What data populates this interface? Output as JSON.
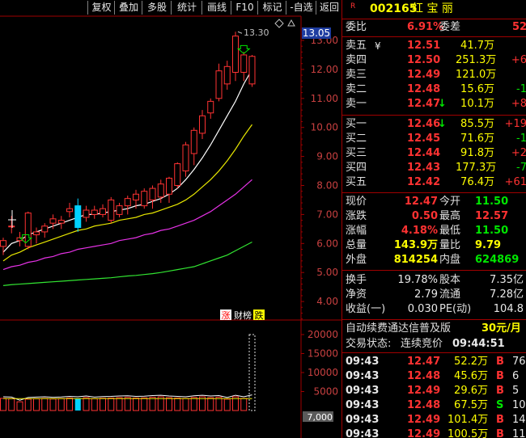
{
  "toolbar": {
    "buttons": [
      "复权",
      "叠加",
      "多股",
      "统计",
      "画线",
      "F10",
      "标记",
      "-自选",
      "返回"
    ]
  },
  "chart": {
    "price_axis_labels": [
      "13.00",
      "12.00",
      "11.00",
      "10.00",
      "9.00",
      "8.00",
      "7.00",
      "6.00",
      "5.00",
      "4.00"
    ],
    "current_price_tag": "13.05",
    "high_label": "13.30",
    "badge_zhang": "涨",
    "badge_caibang": "财榜",
    "badge_die": "跌",
    "volume_axis_labels": [
      "20000",
      "15000",
      "10000",
      "5000"
    ],
    "volume_label": "7,000",
    "colors": {
      "up": "#ff3232",
      "down": "#00d2ff",
      "ma5": "#ffffff",
      "ma10": "#e6e600",
      "ma20": "#e632e6",
      "ma60": "#32e632",
      "grid": "#a00000"
    }
  },
  "chart_data": {
    "type": "candlestick",
    "candles": [
      {
        "o": 5.9,
        "h": 6.2,
        "l": 5.6,
        "c": 6.1
      },
      {
        "o": 6.6,
        "h": 6.95,
        "l": 6.35,
        "c": 6.6
      },
      {
        "o": 6.1,
        "h": 6.4,
        "l": 5.9,
        "c": 6.2
      },
      {
        "o": 5.9,
        "h": 7.1,
        "l": 5.8,
        "c": 7.05
      },
      {
        "o": 6.3,
        "h": 6.55,
        "l": 6.0,
        "c": 6.4
      },
      {
        "o": 6.4,
        "h": 6.7,
        "l": 6.2,
        "c": 6.6
      },
      {
        "o": 6.7,
        "h": 7.0,
        "l": 6.5,
        "c": 6.85
      },
      {
        "o": 6.7,
        "h": 6.95,
        "l": 6.5,
        "c": 6.8
      },
      {
        "o": 7.1,
        "h": 7.4,
        "l": 6.9,
        "c": 7.2
      },
      {
        "o": 7.3,
        "h": 7.55,
        "l": 6.4,
        "c": 6.55
      },
      {
        "o": 6.9,
        "h": 7.3,
        "l": 6.75,
        "c": 7.15
      },
      {
        "o": 7.0,
        "h": 7.3,
        "l": 6.85,
        "c": 7.15
      },
      {
        "o": 7.0,
        "h": 7.35,
        "l": 6.9,
        "c": 7.2
      },
      {
        "o": 6.8,
        "h": 7.6,
        "l": 6.7,
        "c": 7.5
      },
      {
        "o": 7.0,
        "h": 7.4,
        "l": 6.9,
        "c": 7.3
      },
      {
        "o": 7.3,
        "h": 7.65,
        "l": 7.0,
        "c": 7.55
      },
      {
        "o": 7.5,
        "h": 7.85,
        "l": 7.2,
        "c": 7.7
      },
      {
        "o": 7.3,
        "h": 7.9,
        "l": 7.2,
        "c": 7.8
      },
      {
        "o": 7.5,
        "h": 8.0,
        "l": 7.2,
        "c": 7.9
      },
      {
        "o": 7.6,
        "h": 8.2,
        "l": 7.4,
        "c": 8.05
      },
      {
        "o": 7.7,
        "h": 8.3,
        "l": 7.4,
        "c": 8.25
      },
      {
        "o": 8.0,
        "h": 8.8,
        "l": 7.9,
        "c": 8.75
      },
      {
        "o": 8.5,
        "h": 9.5,
        "l": 8.3,
        "c": 9.4
      },
      {
        "o": 9.1,
        "h": 10.0,
        "l": 8.7,
        "c": 9.9
      },
      {
        "o": 9.8,
        "h": 10.6,
        "l": 9.6,
        "c": 10.4
      },
      {
        "o": 10.5,
        "h": 11.0,
        "l": 10.3,
        "c": 10.9
      },
      {
        "o": 11.0,
        "h": 12.2,
        "l": 10.9,
        "c": 11.95
      },
      {
        "o": 11.5,
        "h": 12.3,
        "l": 11.3,
        "c": 12.1
      },
      {
        "o": 11.9,
        "h": 13.3,
        "l": 11.6,
        "c": 13.15
      },
      {
        "o": 11.9,
        "h": 12.6,
        "l": 11.6,
        "c": 12.5
      },
      {
        "o": 11.5,
        "h": 12.5,
        "l": 11.4,
        "c": 12.45
      }
    ],
    "ma5": [
      5.7,
      6.0,
      6.1,
      6.3,
      6.4,
      6.5,
      6.6,
      6.7,
      6.8,
      6.9,
      7.0,
      7.0,
      7.05,
      7.1,
      7.15,
      7.2,
      7.3,
      7.35,
      7.45,
      7.55,
      7.7,
      7.9,
      8.2,
      8.55,
      8.95,
      9.4,
      9.9,
      10.4,
      10.9,
      11.5,
      12.0
    ],
    "ma10": [
      5.4,
      5.6,
      5.7,
      5.85,
      5.95,
      6.05,
      6.15,
      6.25,
      6.35,
      6.45,
      6.5,
      6.6,
      6.65,
      6.7,
      6.8,
      6.85,
      6.9,
      7.0,
      7.05,
      7.15,
      7.25,
      7.35,
      7.5,
      7.7,
      7.95,
      8.2,
      8.5,
      8.85,
      9.25,
      9.7,
      10.1
    ],
    "ma20": [
      5.1,
      5.2,
      5.25,
      5.35,
      5.4,
      5.5,
      5.55,
      5.65,
      5.7,
      5.8,
      5.85,
      5.9,
      5.95,
      6.0,
      6.1,
      6.15,
      6.2,
      6.3,
      6.35,
      6.45,
      6.5,
      6.6,
      6.7,
      6.8,
      6.95,
      7.1,
      7.3,
      7.5,
      7.7,
      7.95,
      8.2
    ],
    "ma60": [
      4.55,
      4.58,
      4.6,
      4.62,
      4.64,
      4.66,
      4.68,
      4.7,
      4.72,
      4.74,
      4.76,
      4.78,
      4.8,
      4.82,
      4.85,
      4.88,
      4.9,
      4.93,
      4.96,
      5.0,
      5.05,
      5.1,
      5.15,
      5.2,
      5.3,
      5.4,
      5.5,
      5.6,
      5.75,
      5.9,
      6.05
    ],
    "volumes": [
      3200,
      3100,
      2300,
      3000,
      3100,
      3200,
      3050,
      3150,
      3300,
      3200,
      3400,
      3100,
      3250,
      3300,
      3400,
      3450,
      3300,
      3350,
      3500,
      3600,
      3400,
      3300,
      3200,
      3450,
      3600,
      3400,
      3500,
      3000,
      3600,
      3200,
      20000
    ],
    "price_ylim": [
      3.5,
      13.5
    ],
    "volume_ylim": [
      0,
      22000
    ]
  },
  "quote": {
    "header": {
      "marker": "R",
      "code": "002165",
      "name": "红 宝 丽"
    },
    "weibi": {
      "label": "委比",
      "value": "6.91%",
      "label2": "委差",
      "value2": "52"
    },
    "asks": [
      {
        "label": "卖五",
        "flag": "¥",
        "price": "12.51",
        "vol": "41.7万",
        "delta": ""
      },
      {
        "label": "卖四",
        "flag": "",
        "price": "12.50",
        "vol": "251.3万",
        "delta": "+6"
      },
      {
        "label": "卖三",
        "flag": "",
        "price": "12.49",
        "vol": "121.0万",
        "delta": ""
      },
      {
        "label": "卖二",
        "flag": "",
        "price": "12.48",
        "vol": "15.6万",
        "delta": "-1"
      },
      {
        "label": "卖一",
        "flag": "↓",
        "price": "12.47",
        "vol": "10.1万",
        "delta": "+8"
      }
    ],
    "bids": [
      {
        "label": "买一",
        "flag": "↓",
        "price": "12.46",
        "vol": "85.5万",
        "delta": "+19"
      },
      {
        "label": "买二",
        "flag": "",
        "price": "12.45",
        "vol": "71.6万",
        "delta": "-1"
      },
      {
        "label": "买三",
        "flag": "",
        "price": "12.44",
        "vol": "91.8万",
        "delta": "+2"
      },
      {
        "label": "买四",
        "flag": "",
        "price": "12.43",
        "vol": "177.3万",
        "delta": "-7"
      },
      {
        "label": "买五",
        "flag": "",
        "price": "12.42",
        "vol": "76.4万",
        "delta": "+61"
      }
    ],
    "stats1": [
      {
        "l1": "现价",
        "v1": "12.47",
        "l2": "今开",
        "v2": "11.50"
      },
      {
        "l1": "涨跌",
        "v1": "0.50",
        "l2": "最高",
        "v2": "12.57"
      },
      {
        "l1": "涨幅",
        "v1": "4.18%",
        "l2": "最低",
        "v2": "11.50"
      },
      {
        "l1": "总量",
        "v1": "143.9万",
        "l2": "量比",
        "v2": "9.79"
      },
      {
        "l1": "外盘",
        "v1": "814254",
        "l2": "内盘",
        "v2": "624869"
      }
    ],
    "stats2": [
      {
        "l1": "换手",
        "v1": "19.78%",
        "l2": "股本",
        "v2": "7.35亿"
      },
      {
        "l1": "净资",
        "v1": "2.79",
        "l2": "流通",
        "v2": "7.28亿"
      },
      {
        "l1": "收益(一)",
        "v1": "0.030",
        "l2": "PE(动)",
        "v2": "104.8"
      }
    ],
    "promo": {
      "text": "自动续费通达信普及版",
      "price": "30元/月"
    },
    "status": {
      "label": "交易状态:",
      "value": "连续竞价",
      "time": "09:44:51"
    },
    "ticks": [
      {
        "time": "09:43",
        "price": "12.47",
        "vol": "52.2万",
        "bs": "B",
        "n": "76"
      },
      {
        "time": "09:43",
        "price": "12.48",
        "vol": "45.6万",
        "bs": "B",
        "n": "6"
      },
      {
        "time": "09:43",
        "price": "12.49",
        "vol": "29.6万",
        "bs": "B",
        "n": "5"
      },
      {
        "time": "09:43",
        "price": "12.48",
        "vol": "67.5万",
        "bs": "S",
        "n": "10"
      },
      {
        "time": "09:43",
        "price": "12.49",
        "vol": "101.4万",
        "bs": "B",
        "n": "14"
      },
      {
        "time": "09:43",
        "price": "12.49",
        "vol": "100.5万",
        "bs": "B",
        "n": "11"
      }
    ]
  }
}
